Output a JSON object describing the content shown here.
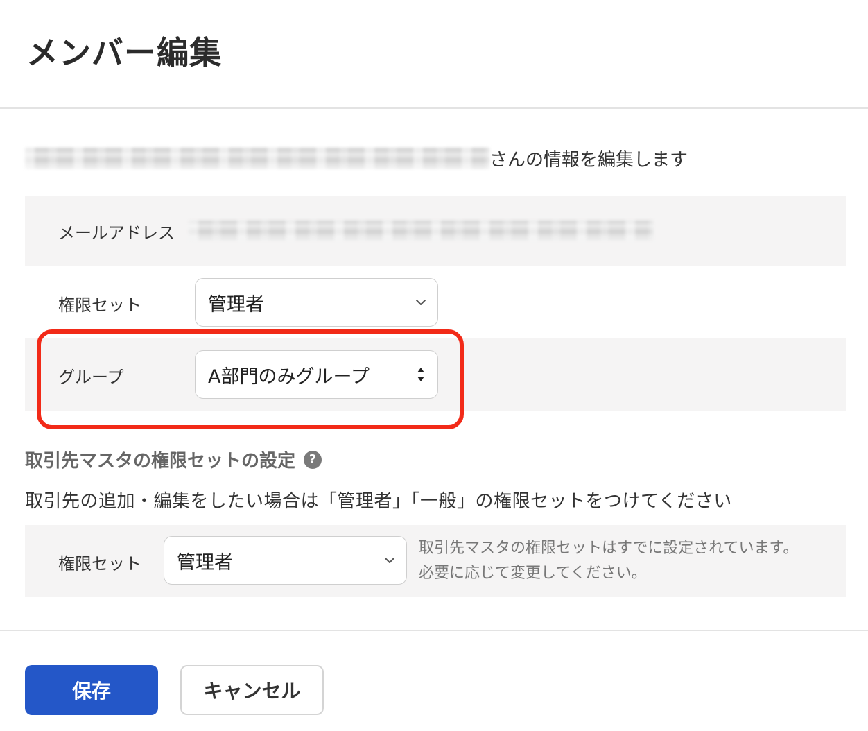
{
  "dialog": {
    "title": "メンバー編集",
    "intro_suffix": "さんの情報を編集します"
  },
  "fields": {
    "email_label": "メールアドレス",
    "permission_label": "権限セット",
    "permission_value": "管理者",
    "group_label": "グループ",
    "group_value": "A部門のみグループ"
  },
  "partner_section": {
    "title": "取引先マスタの権限セットの設定",
    "help_icon": "question-circle-icon",
    "description": "取引先の追加・編集をしたい場合は「管理者」「一般」の権限セットをつけてください",
    "permission_label": "権限セット",
    "permission_value": "管理者",
    "note": "取引先マスタの権限セットはすでに設定されています。必要に応じて変更してください。"
  },
  "buttons": {
    "save": "保存",
    "cancel": "キャンセル"
  },
  "colors": {
    "primary": "#2457c8",
    "highlight": "#f22a18",
    "shaded_row": "#f5f4f4"
  }
}
